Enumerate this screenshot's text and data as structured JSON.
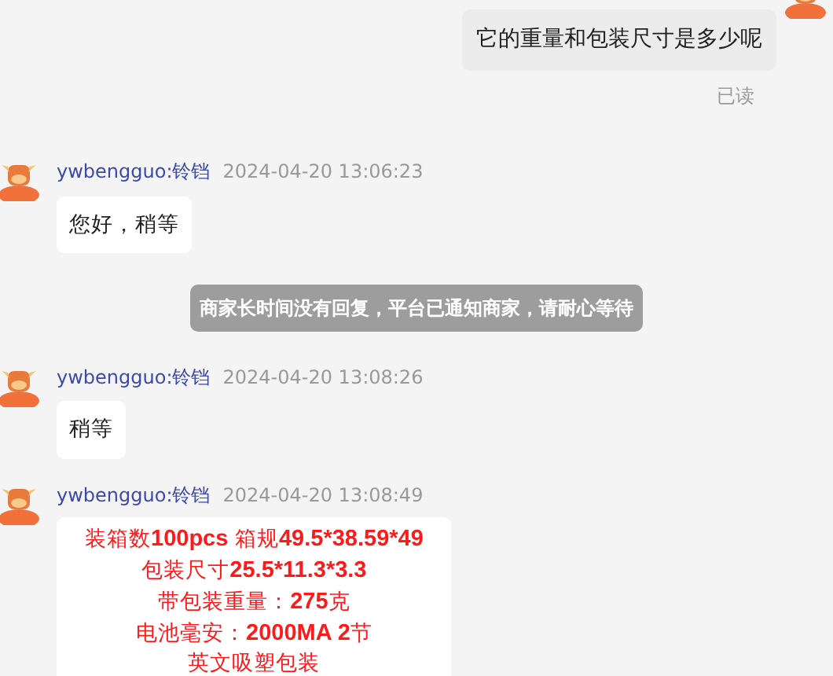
{
  "outgoing": {
    "text": "它的重量和包装尺寸是多少呢",
    "read_status": "已读"
  },
  "items": [
    {
      "kind": "message",
      "sender": "ywbengguo:铃铛",
      "time": "2024-04-20 13:06:23",
      "lines": [
        "您好，稍等"
      ]
    },
    {
      "kind": "notice",
      "text": "商家长时间没有回复，平台已通知商家，请耐心等待"
    },
    {
      "kind": "message",
      "sender": "ywbengguo:铃铛",
      "time": "2024-04-20 13:08:26",
      "lines": [
        "稍等"
      ]
    },
    {
      "kind": "rich",
      "sender": "ywbengguo:铃铛",
      "time": "2024-04-20 13:08:49",
      "lines": [
        "装箱数**100pcs**  箱规**49.5*38.59*49**",
        "包装尺寸**25.5*11.3*3.3**",
        "带包装重量：**275**克",
        "电池毫安：**2000MA 2**节",
        "英文吸塑包装"
      ]
    }
  ]
}
